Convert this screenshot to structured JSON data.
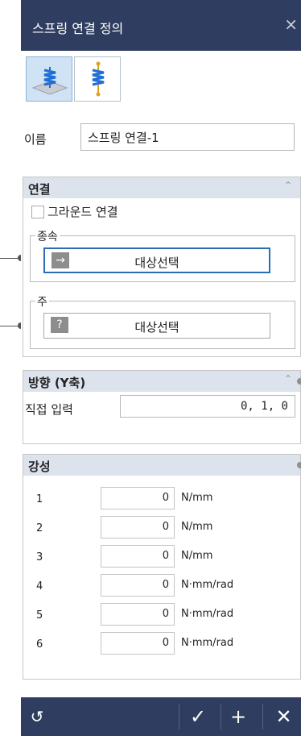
{
  "dialog": {
    "title": "스프링 연결 정의",
    "close_glyph": "×"
  },
  "mode_buttons": [
    {
      "name": "ground-spring-mode",
      "icon": "ground-spring-icon",
      "selected": true
    },
    {
      "name": "spring-mode",
      "icon": "spring-icon",
      "selected": false
    }
  ],
  "name_field": {
    "label": "이름",
    "value": "스프링 연결-1"
  },
  "connection": {
    "header": "연결",
    "ground_checkbox": {
      "label": "그라운드 연결",
      "checked": false
    },
    "slave": {
      "label": "종속",
      "button": "대상선택",
      "icon": "arrow-right-icon",
      "active": true
    },
    "master": {
      "label": "주",
      "button": "대상선택",
      "icon": "question-icon",
      "active": false
    }
  },
  "direction": {
    "header": "방향 (Y축)",
    "input_label": "직접 입력",
    "value": "0, 1, 0"
  },
  "stiffness": {
    "header": "강성",
    "rows": [
      {
        "index": "1",
        "value": "0",
        "unit": "N/mm"
      },
      {
        "index": "2",
        "value": "0",
        "unit": "N/mm"
      },
      {
        "index": "3",
        "value": "0",
        "unit": "N/mm"
      },
      {
        "index": "4",
        "value": "0",
        "unit": "N·mm/rad"
      },
      {
        "index": "5",
        "value": "0",
        "unit": "N·mm/rad"
      },
      {
        "index": "6",
        "value": "0",
        "unit": "N·mm/rad"
      }
    ]
  },
  "bottom_bar": {
    "reset_glyph": "↺",
    "ok_glyph": "✓",
    "add_glyph": "+",
    "cancel_glyph": "✕"
  },
  "colors": {
    "titlebar": "#2f3e60",
    "section_header": "#dde3ec",
    "active_border": "#2a6db3",
    "spring_blue": "#1f6fd6"
  }
}
